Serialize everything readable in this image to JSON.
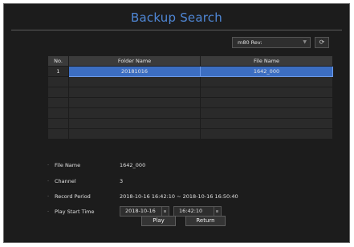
{
  "title": "Backup Search",
  "device_select": {
    "value": "m80 Rev:"
  },
  "table": {
    "headers": [
      "No.",
      "Folder Name",
      "File Name"
    ],
    "rows": [
      {
        "no": "1",
        "folder": "20181016",
        "file": "1642_000"
      },
      {
        "no": "",
        "folder": "",
        "file": ""
      },
      {
        "no": "",
        "folder": "",
        "file": ""
      },
      {
        "no": "",
        "folder": "",
        "file": ""
      },
      {
        "no": "",
        "folder": "",
        "file": ""
      },
      {
        "no": "",
        "folder": "",
        "file": ""
      },
      {
        "no": "",
        "folder": "",
        "file": ""
      }
    ]
  },
  "info": {
    "file_name": {
      "label": "File Name",
      "value": "1642_000"
    },
    "channel": {
      "label": "Channel",
      "value": "3"
    },
    "record_period": {
      "label": "Record Period",
      "value": "2018-10-16 16:42:10 ~ 2018-10-16 16:50:40"
    },
    "play_start_time": {
      "label": "Play Start Time",
      "date": "2018-10-16",
      "time": "16:42:10"
    }
  },
  "buttons": {
    "play": "Play",
    "return": "Return"
  },
  "colors": {
    "accent": "#4f87d6",
    "selected_row": "#3c6ec2",
    "background": "#1c1c1c"
  },
  "icons": {
    "refresh": "refresh-icon",
    "dropdown": "chevron-down-icon"
  }
}
